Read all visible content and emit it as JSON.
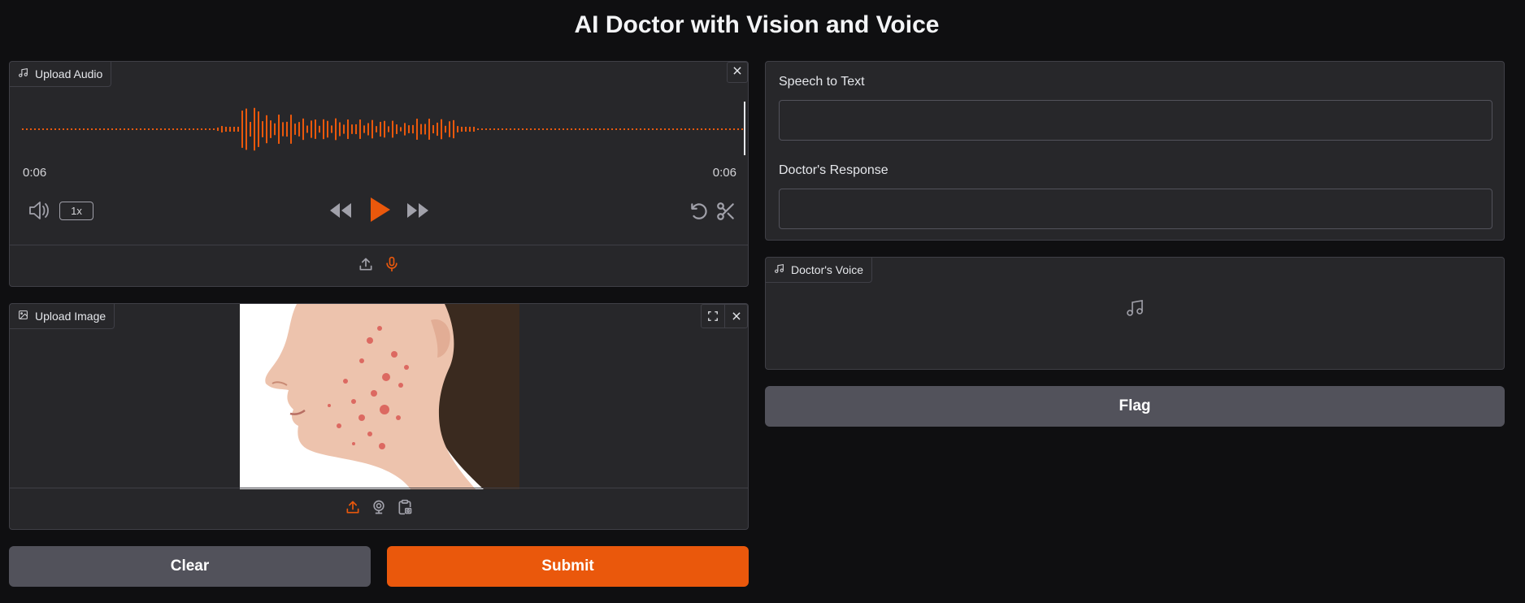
{
  "app": {
    "title": "AI Doctor with Vision and Voice"
  },
  "audio_input": {
    "label": "Upload Audio",
    "current_time": "0:06",
    "duration": "0:06",
    "playback_speed": "1x",
    "icons": [
      "music-icon",
      "close-icon",
      "volume-icon",
      "rewind-icon",
      "play-icon",
      "fast-forward-icon",
      "undo-icon",
      "scissors-icon",
      "upload-icon",
      "microphone-icon"
    ]
  },
  "image_input": {
    "label": "Upload Image",
    "image_description": "side profile of a face with acne on the cheek",
    "icons": [
      "image-icon",
      "fullscreen-icon",
      "close-icon",
      "upload-icon",
      "webcam-icon",
      "clipboard-icon"
    ]
  },
  "buttons": {
    "clear": "Clear",
    "submit": "Submit",
    "flag": "Flag"
  },
  "outputs": {
    "speech_to_text_label": "Speech to Text",
    "speech_to_text_value": "",
    "doctor_response_label": "Doctor's Response",
    "doctor_response_value": "",
    "doctor_voice_label": "Doctor's Voice"
  },
  "colors": {
    "accent": "#ea580c",
    "background": "#0f0f11",
    "panel": "#27272a",
    "secondary_button": "#52525b"
  }
}
